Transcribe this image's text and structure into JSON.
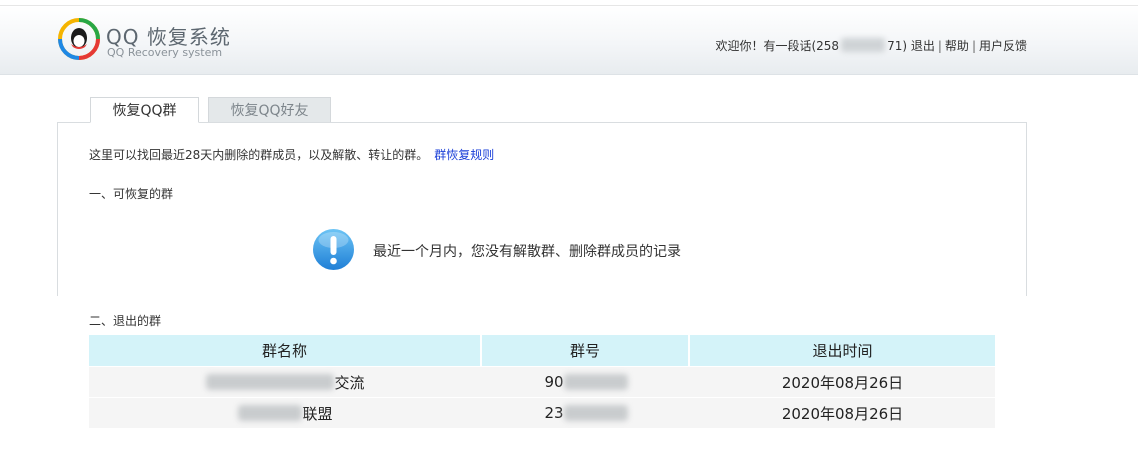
{
  "header": {
    "logo_title": "QQ 恢复系统",
    "logo_subtitle": "QQ Recovery system",
    "welcome_prefix": "欢迎你！有一段话(258",
    "welcome_suffix": "71)",
    "logout": "退出",
    "help": "帮助",
    "feedback": "用户反馈",
    "separator": "|"
  },
  "tabs": [
    {
      "label": "恢复QQ群",
      "active": true
    },
    {
      "label": "恢复QQ好友",
      "active": false
    }
  ],
  "main": {
    "intro_text": "这里可以找回最近28天内删除的群成员，以及解散、转让的群。",
    "rules_link": "群恢复规则",
    "section1_title": "一、可恢复的群",
    "empty_message": "最近一个月内，您没有解散群、删除群成员的记录",
    "section2_title": "二、退出的群"
  },
  "table": {
    "headers": [
      "群名称",
      "群号",
      "退出时间"
    ],
    "rows": [
      {
        "name_visible": "交流",
        "number_visible": "90",
        "time": "2020年08月26日"
      },
      {
        "name_visible": "联盟",
        "number_visible": "23",
        "time": "2020年08月26日"
      }
    ]
  },
  "colors": {
    "table_header_bg": "#d4f3f9",
    "link": "#1a3fd8",
    "info_icon": "#2b8fe0"
  }
}
